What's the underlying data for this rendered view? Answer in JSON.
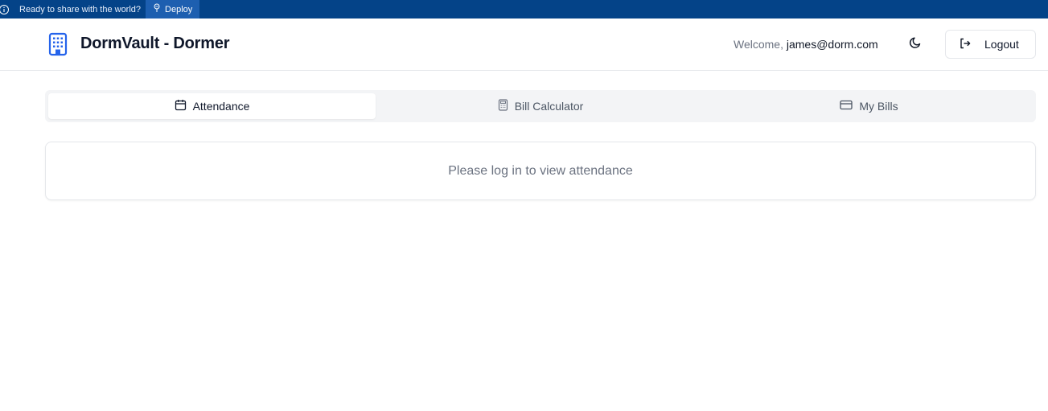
{
  "banner": {
    "text": "Ready to share with the world?",
    "deploy_label": "Deploy",
    "background": "#044388"
  },
  "header": {
    "app_title": "DormVault - Dormer",
    "brand_icon": "building-icon",
    "brand_color": "#2563eb",
    "welcome_prefix": "Welcome,",
    "user_email": "james@dorm.com",
    "theme_icon": "moon-icon",
    "logout_label": "Logout",
    "logout_icon": "logout-icon"
  },
  "tabs": [
    {
      "label": "Attendance",
      "icon": "calendar-icon",
      "active": true
    },
    {
      "label": "Bill Calculator",
      "icon": "calculator-icon",
      "active": false
    },
    {
      "label": "My Bills",
      "icon": "credit-card-icon",
      "active": false
    }
  ],
  "main": {
    "message": "Please log in to view attendance"
  }
}
